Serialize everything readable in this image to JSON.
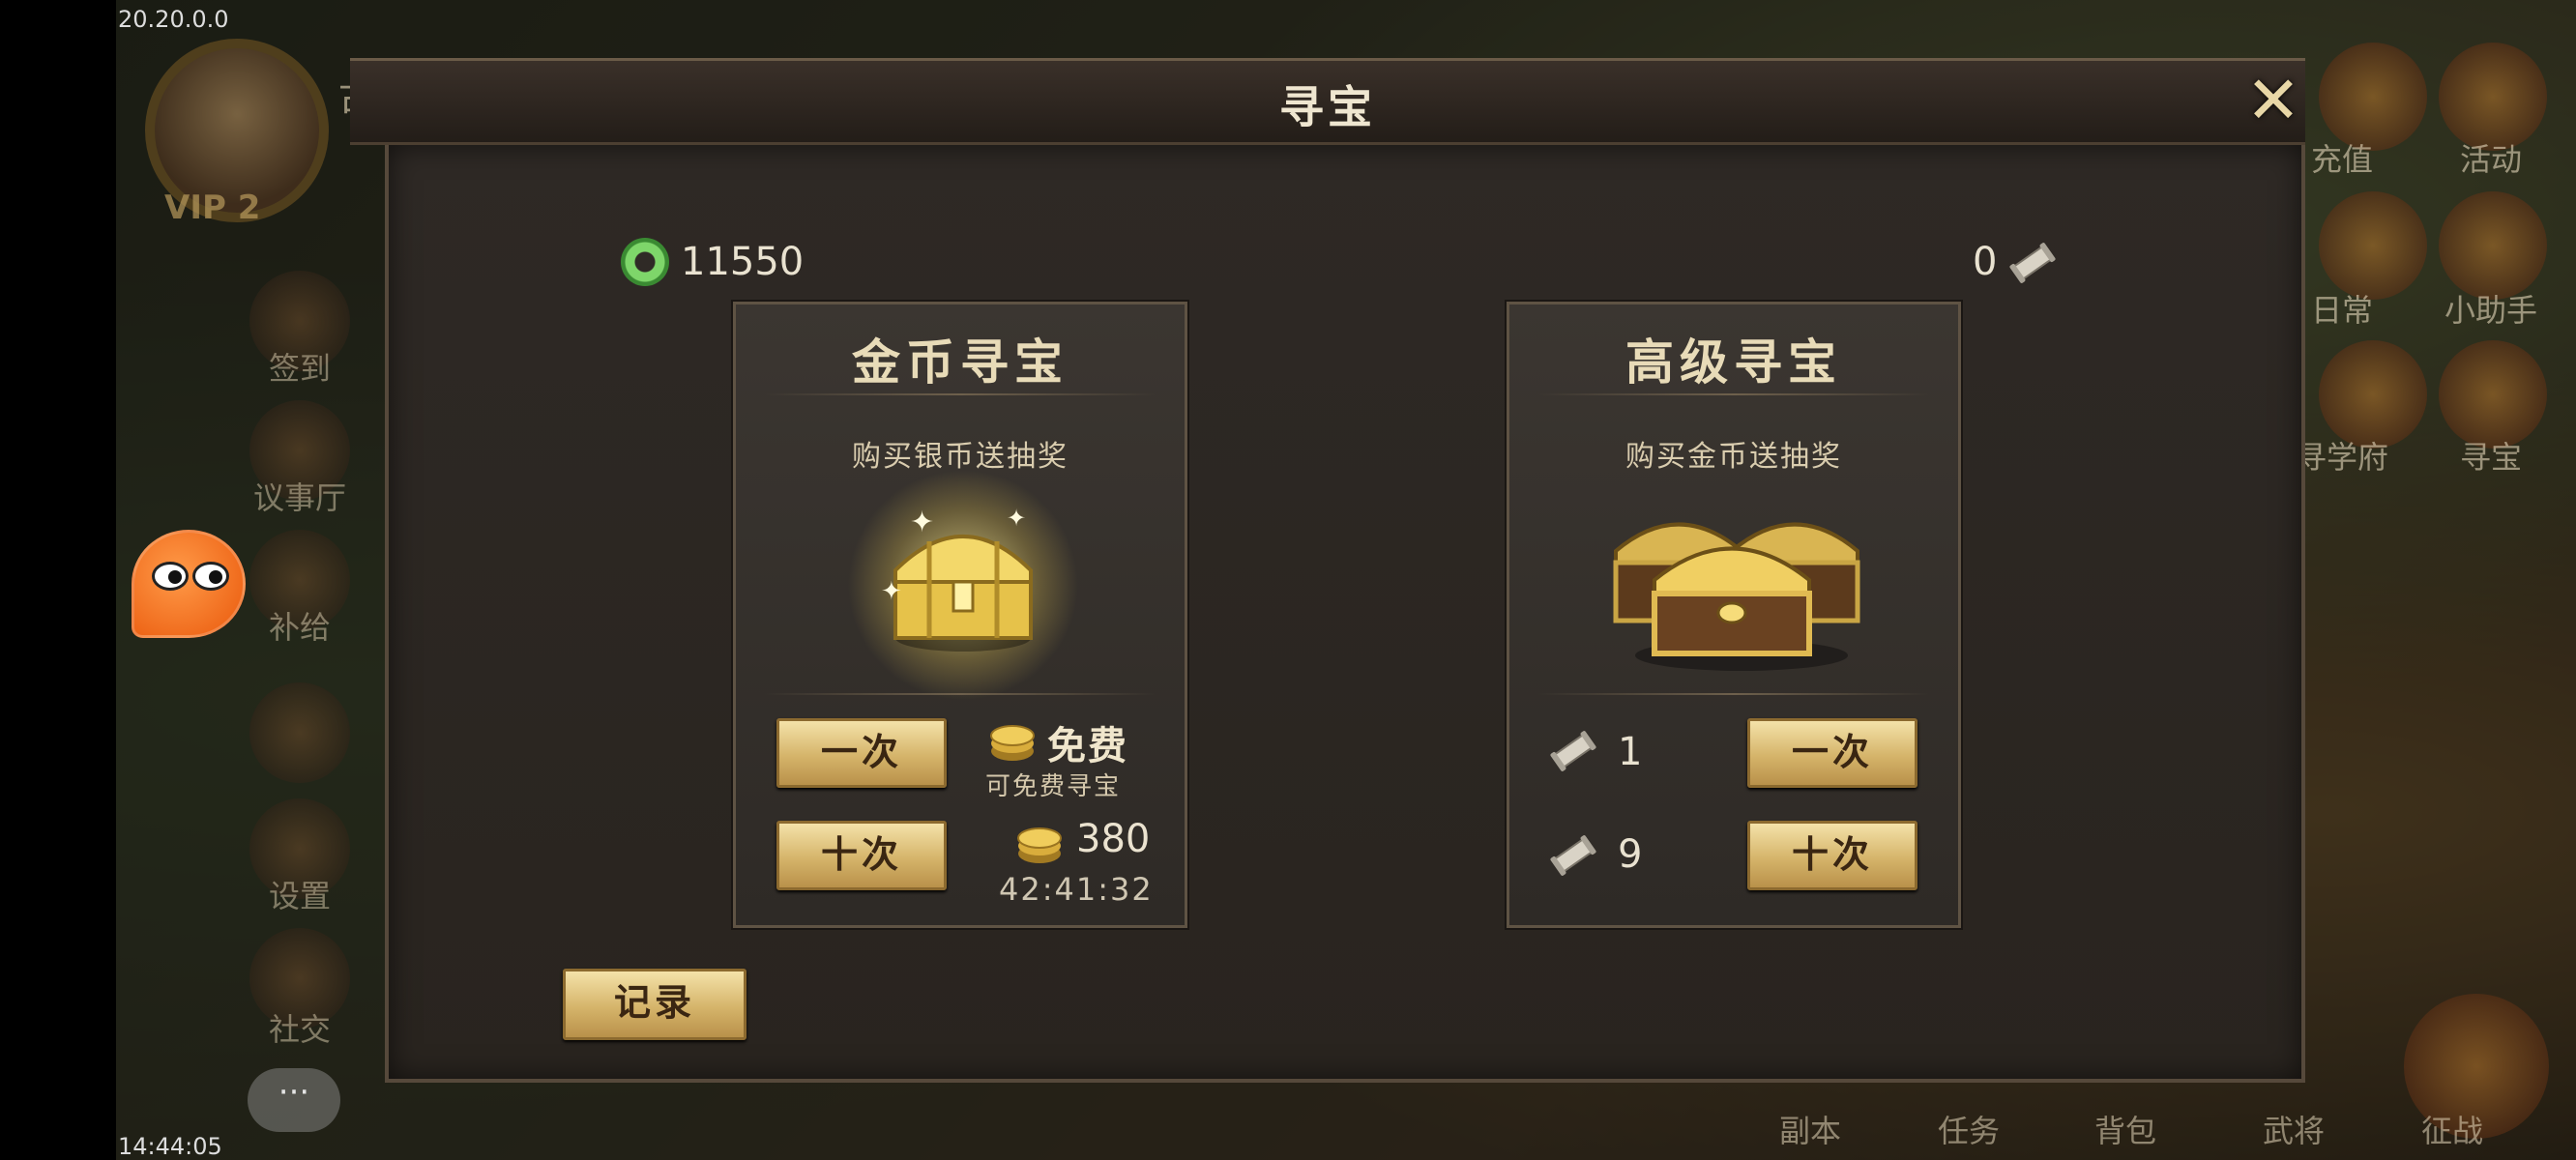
{
  "status": {
    "ip": "20.20.0.0",
    "clock": "14:44:05"
  },
  "hud": {
    "vip": "VIP 2",
    "ancient": "古",
    "help": "?",
    "left_items": [
      "签到",
      "议事厅",
      "补给",
      "设置",
      "社交"
    ],
    "right_items": [
      "充值",
      "活动",
      "日常",
      "小助手",
      "寻学府",
      "寻宝"
    ],
    "bottom_items": [
      "副本",
      "任务",
      "背包",
      "武将",
      "征战"
    ],
    "chat": "···"
  },
  "dialog": {
    "title": "寻宝",
    "close_glyph": "✕",
    "silver_amount": "11550",
    "scroll_amount": "0",
    "record_label": "记录",
    "cards": [
      {
        "title": "金币寻宝",
        "subtitle": "购买银币送抽奖",
        "once_label": "一次",
        "ten_label": "十次",
        "free_label": "免费",
        "free_hint": "可免费寻宝",
        "ten_cost": "380",
        "timer": "42:41:32"
      },
      {
        "title": "高级寻宝",
        "subtitle": "购买金币送抽奖",
        "once_label": "一次",
        "ten_label": "十次",
        "once_cost": "1",
        "ten_cost": "9"
      }
    ]
  },
  "colors": {
    "button_gold": "#d5b46a",
    "accent_green": "#7ed66a",
    "panel": "#2e2925"
  },
  "icons": [
    "silver-coin-icon",
    "scroll-icon",
    "gold-coin-icon",
    "treasure-chest-icon",
    "close-icon",
    "help-icon",
    "chat-icon"
  ]
}
